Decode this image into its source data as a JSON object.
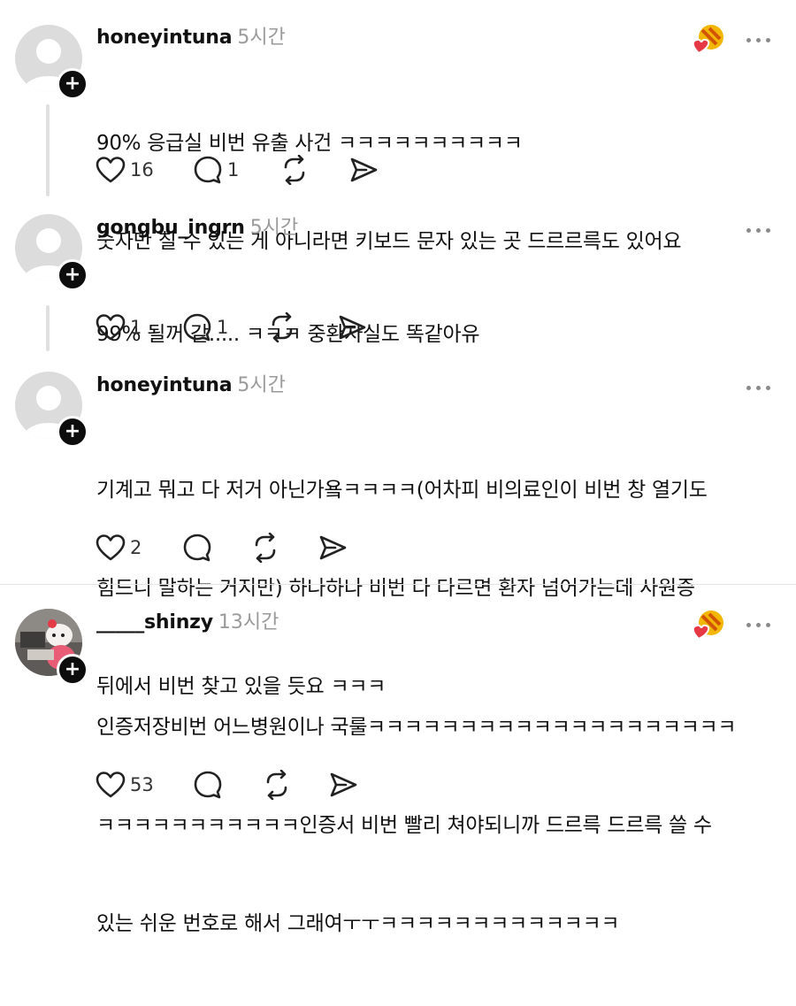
{
  "posts": [
    {
      "username": "honeyintuna",
      "time": "5시간",
      "lines": [
        "90% 응급실 비번 유출 사건 ㅋㅋㅋㅋㅋㅋㅋㅋㅋㅋ",
        "숫자만 칠 수 있는 게 아니라면 키보드 문자 있는 곳 드르르륵도 있어요"
      ],
      "likes": "16",
      "replies": "1"
    },
    {
      "username": "gongbu_ingrn",
      "time": "5시간",
      "lines": [
        "99% 될꺼 같..... ㅋㅋㅋ 중환자실도 똑같아유"
      ],
      "likes": "1",
      "replies": "1"
    },
    {
      "username": "honeyintuna",
      "time": "5시간",
      "lines": [
        "기계고 뭐고 다 저거 아닌가욬ㅋㅋㅋㅋ(어차피 비의료인이 비번 창 열기도",
        "힘드니 말하는 거지만) 하나하나 비번 다 다르면 환자 넘어가는데 사원증",
        "뒤에서 비번 찾고 있을 듯요 ㅋㅋㅋ"
      ],
      "likes": "2",
      "replies": ""
    },
    {
      "username": "_____shinzy",
      "time": "13시간",
      "lines": [
        "인증저장비번 어느병원이나 국룰ㅋㅋㅋㅋㅋㅋㅋㅋㅋㅋㅋㅋㅋㅋㅋㅋㅋㅋㅋㅋ",
        "ㅋㅋㅋㅋㅋㅋㅋㅋㅋㅋㅋ인증서 비번 빨리 쳐야되니까 드르륵 드르륵 쓸 수",
        "있는 쉬운 번호로 해서 그래여ㅜㅜㅋㅋㅋㅋㅋㅋㅋㅋㅋㅋㅋㅋㅋ"
      ],
      "likes": "53",
      "replies": ""
    }
  ],
  "icons": {
    "like": "heart-icon",
    "reply": "comment-bubble-icon",
    "repost": "repost-icon",
    "share": "send-icon",
    "follow": "plus-icon",
    "more": "more-dots-icon",
    "badge": "heart-badge-icon"
  },
  "colors": {
    "username": "#111111",
    "time": "#9a9a9a",
    "follow_bg": "#0d0d0d",
    "badge_red": "#e63946",
    "badge_yellow": "#f2b705"
  }
}
